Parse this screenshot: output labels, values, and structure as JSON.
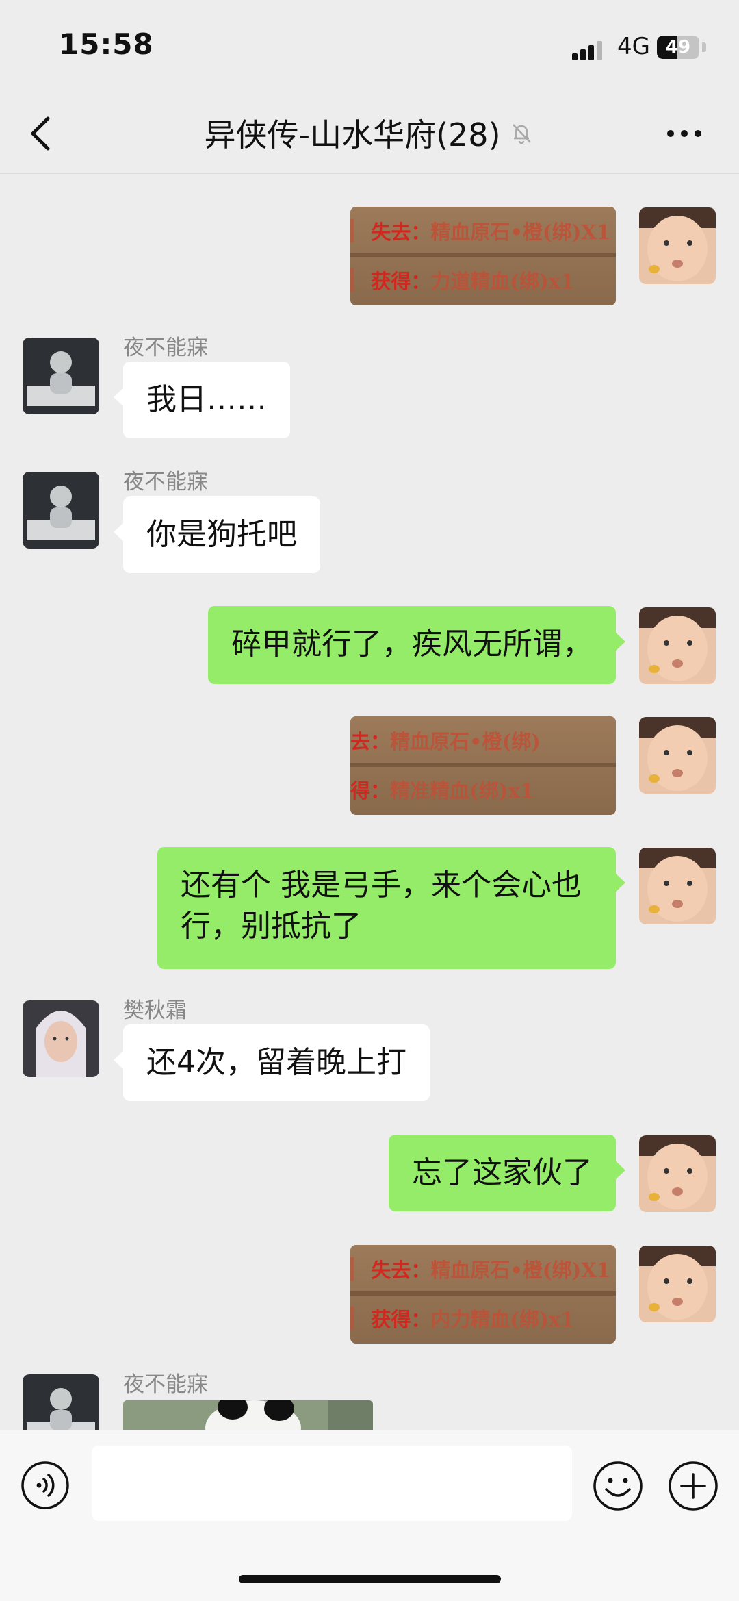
{
  "status_bar": {
    "time": "15:58",
    "network": "4G",
    "battery": "49",
    "battery_level": 0.49
  },
  "nav": {
    "title": "异侠传-山水华府(28)",
    "back_icon": "chevron-left-icon",
    "mute_icon": "bell-slash-icon",
    "more_icon": "ellipsis-icon"
  },
  "messages": [
    {
      "side": "right",
      "type": "image",
      "loot": {
        "lost_label": "失去：",
        "lost_item": "精血原石•橙(绑)X1",
        "gain_label": "获得：",
        "gain_item": "力道精血(绑)x1"
      }
    },
    {
      "side": "left",
      "sender": "夜不能寐",
      "type": "text",
      "text": "我日……"
    },
    {
      "side": "left",
      "sender": "夜不能寐",
      "type": "text",
      "text": "你是狗托吧"
    },
    {
      "side": "right",
      "type": "text",
      "text": "碎甲就行了，疾风无所谓，"
    },
    {
      "side": "right",
      "type": "image",
      "loot": {
        "lost_label": "去：",
        "lost_item": "精血原石•橙(绑)",
        "gain_label": "得：",
        "gain_item": "精准精血(绑)x1"
      }
    },
    {
      "side": "right",
      "type": "text",
      "text_line1": "还有个 我是弓手，来个会心也",
      "text_line2": "行，别抵抗了"
    },
    {
      "side": "left",
      "sender": "樊秋霜",
      "type": "text",
      "text": "还4次，留着晚上打"
    },
    {
      "side": "right",
      "type": "text",
      "text": "忘了这家伙了"
    },
    {
      "side": "right",
      "type": "image",
      "loot": {
        "lost_label": "失去：",
        "lost_item": "精血原石•橙(绑)X1",
        "gain_label": "获得：",
        "gain_item": "内力精血(绑)x1"
      }
    },
    {
      "side": "left",
      "sender": "夜不能寐",
      "type": "image"
    }
  ],
  "input_bar": {
    "placeholder": "",
    "voice_icon": "voice-icon",
    "emoji_icon": "emoji-icon",
    "plus_icon": "plus-circle-icon"
  },
  "colors": {
    "background": "#ededed",
    "my_bubble": "#95ec69",
    "their_bubble": "#ffffff",
    "loot_text": "#d2271f"
  }
}
